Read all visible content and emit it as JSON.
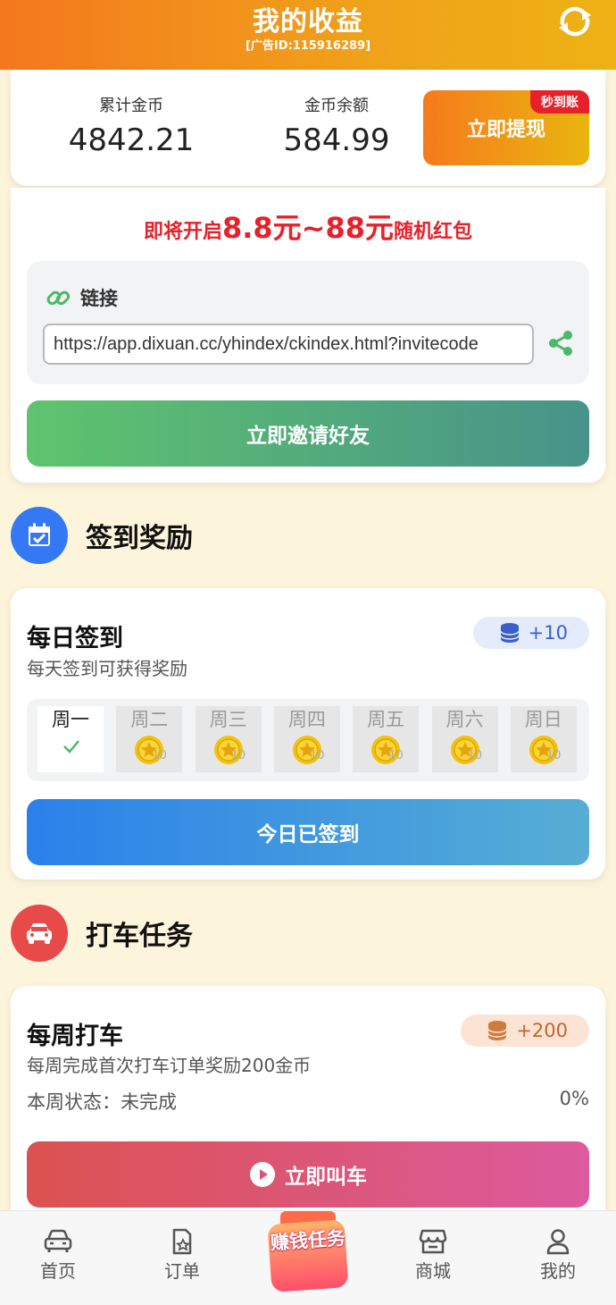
{
  "header": {
    "title": "我的收益",
    "ad_id": "[广告ID:115916289]",
    "icon": "refresh-icon"
  },
  "earnings": {
    "total_label": "累计金币",
    "total_value": "4842.21",
    "balance_label": "金币余额",
    "balance_value": "584.99",
    "withdraw_label": "立即提现",
    "withdraw_badge": "秒到账"
  },
  "invite": {
    "promo_prefix": "即将开启",
    "promo_amount": "8.8元~88元",
    "promo_suffix": "随机红包",
    "link_label": "链接",
    "link_value": "https://app.dixuan.cc/yhindex/ckindex.html?invitecode",
    "invite_button": "立即邀请好友"
  },
  "checkin_section": {
    "title": "签到奖励",
    "card_title": "每日签到",
    "card_subtitle": "每天签到可获得奖励",
    "reward": "+10",
    "days": [
      {
        "name": "周一",
        "done": true,
        "value": ""
      },
      {
        "name": "周二",
        "done": false,
        "value": "10"
      },
      {
        "name": "周三",
        "done": false,
        "value": "10"
      },
      {
        "name": "周四",
        "done": false,
        "value": "10"
      },
      {
        "name": "周五",
        "done": false,
        "value": "10"
      },
      {
        "name": "周六",
        "done": false,
        "value": "10"
      },
      {
        "name": "周日",
        "done": false,
        "value": "10"
      }
    ],
    "button": "今日已签到"
  },
  "taxi_section": {
    "title": "打车任务",
    "card_title": "每周打车",
    "card_subtitle": "每周完成首次打车订单奖励200金币",
    "reward": "+200",
    "status_text": "本周状态：未完成",
    "progress": "0%",
    "button": "立即叫车"
  },
  "nav": {
    "home": "首页",
    "orders": "订单",
    "task": "赚钱任务",
    "mall": "商城",
    "mine": "我的"
  },
  "colors": {
    "header_start": "#f4781e",
    "header_end": "#eeb214",
    "promo_red": "#e8202a",
    "checkin_blue": "#3478f6",
    "taxi_red": "#e84a4a"
  }
}
